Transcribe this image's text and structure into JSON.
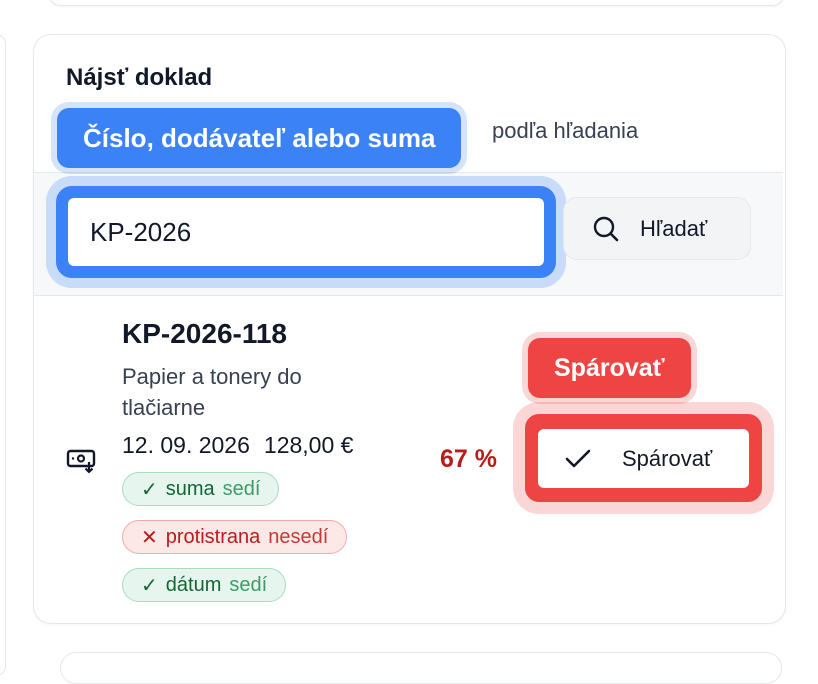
{
  "finder": {
    "title": "Nájsť doklad",
    "subtitle_visible": "podľa hľadania",
    "search_tag": "Číslo, dodávateľ alebo suma",
    "search_value": "KP-2026",
    "search_button_label": "Hľadať"
  },
  "result": {
    "number": "KP-2026-118",
    "description": "Papier a tonery do tlačiarne",
    "date": "12. 09. 2026",
    "amount": "128,00 €",
    "match_percent": "67 %",
    "badges": [
      {
        "field": "suma",
        "state": "sedí",
        "status": "ok",
        "mark": "✓"
      },
      {
        "field": "protistrana",
        "state": "nesedí",
        "status": "bad",
        "mark": "✕"
      },
      {
        "field": "dátum",
        "state": "sedí",
        "status": "ok",
        "mark": "✓"
      }
    ],
    "pair_tag": "Spárovať",
    "pair_button_label": "Spárovať"
  },
  "colors": {
    "accent_blue": "#3b82f6",
    "accent_red": "#ef4444",
    "ok_green": "#166534",
    "bad_red": "#b91c1c"
  },
  "icons": {
    "search_button": "search-icon",
    "document": "cash-download-icon",
    "pair_button": "check-icon"
  }
}
